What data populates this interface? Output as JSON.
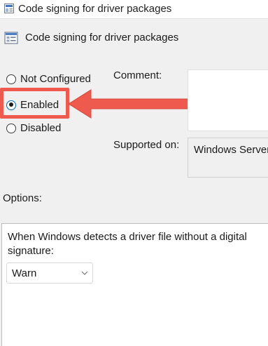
{
  "window": {
    "title": "Code signing for driver packages"
  },
  "policy": {
    "name": "Code signing for driver packages"
  },
  "state_options": [
    {
      "label": "Not Configured",
      "checked": false
    },
    {
      "label": "Enabled",
      "checked": true
    },
    {
      "label": "Disabled",
      "checked": false
    }
  ],
  "comment": {
    "label": "Comment:",
    "value": ""
  },
  "supported_on": {
    "label": "Supported on:",
    "value": "Windows Server"
  },
  "options": {
    "label": "Options:",
    "description": "When Windows detects a driver file without a digital signature:",
    "dropdown": {
      "selected": "Warn"
    }
  },
  "colors": {
    "highlight": "#ef5a4e",
    "radio_accent": "#0067c0"
  },
  "icons": [
    "policy-window-icon",
    "policy-settings-icon",
    "chevron-down-icon",
    "red-arrow-icon"
  ]
}
